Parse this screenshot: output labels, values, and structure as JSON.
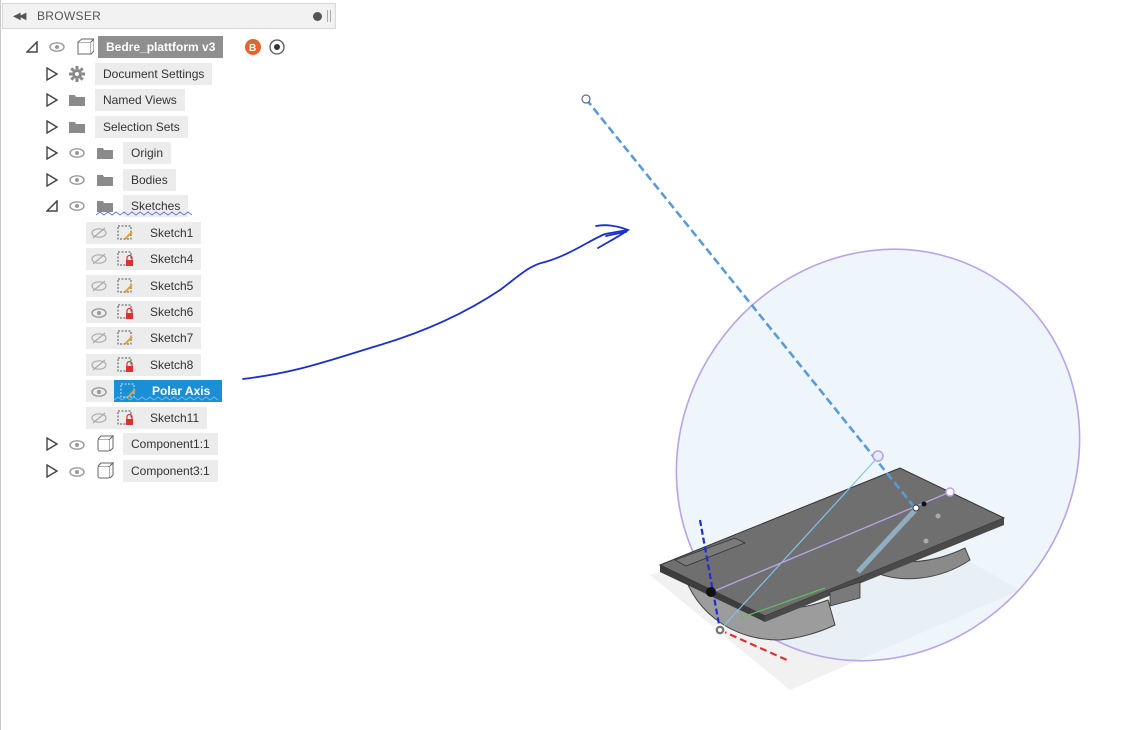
{
  "browser": {
    "title": "BROWSER"
  },
  "tree": {
    "root": {
      "label": "Bedre_plattform v3"
    },
    "items": [
      {
        "label": "Document Settings"
      },
      {
        "label": "Named Views"
      },
      {
        "label": "Selection Sets"
      },
      {
        "label": "Origin"
      },
      {
        "label": "Bodies"
      },
      {
        "label": "Sketches"
      }
    ],
    "sketches": [
      {
        "label": "Sketch1"
      },
      {
        "label": "Sketch4"
      },
      {
        "label": "Sketch5"
      },
      {
        "label": "Sketch6"
      },
      {
        "label": "Sketch7"
      },
      {
        "label": "Sketch8"
      },
      {
        "label": "Polar Axis"
      },
      {
        "label": "Sketch11"
      }
    ],
    "components": [
      {
        "label": "Component1:1"
      },
      {
        "label": "Component3:1"
      }
    ]
  },
  "colors": {
    "selection": "#1b8fd6",
    "annotation": "#1a2fcc",
    "sketch_line": "#5b9bd5",
    "ellipse": "#b9a3e8"
  }
}
